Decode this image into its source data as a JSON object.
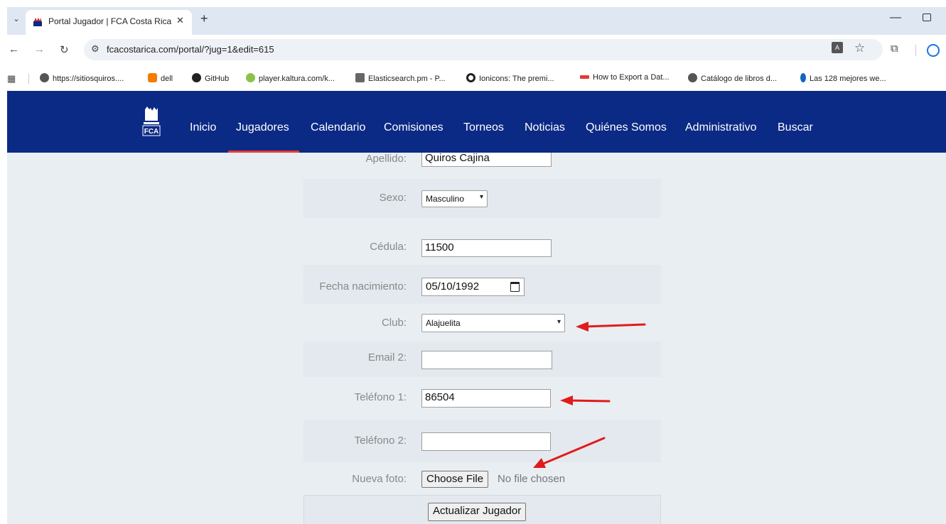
{
  "browser": {
    "tab_title": "Portal Jugador | FCA Costa Rica",
    "url": "fcacostarica.com/portal/?jug=1&edit=615",
    "bookmarks": [
      "https://sitiosquiros....",
      "dell",
      "GitHub",
      "player.kaltura.com/k...",
      "Elasticsearch.pm - P...",
      "Ionicons: The premi...",
      "How to Export a Dat...",
      "Catálogo de libros d...",
      "Las 128 mejores we..."
    ]
  },
  "site": {
    "logo_text": "FCA",
    "nav": [
      "Inicio",
      "Jugadores",
      "Calendario",
      "Comisiones",
      "Torneos",
      "Noticias",
      "Quiénes Somos",
      "Administrativo",
      "Buscar"
    ],
    "active_nav": "Jugadores"
  },
  "form": {
    "apellido": {
      "label": "Apellido:",
      "value": "Quiros Cajina"
    },
    "sexo": {
      "label": "Sexo:",
      "value": "Masculino"
    },
    "cedula": {
      "label": "Cédula:",
      "value": "11500"
    },
    "fecha_nacimiento": {
      "label": "Fecha nacimiento:",
      "value": "05/10/1992"
    },
    "club": {
      "label": "Club:",
      "value": "Alajuelita"
    },
    "email2": {
      "label": "Email 2:",
      "value": ""
    },
    "telefono1": {
      "label": "Teléfono 1:",
      "value": "86504"
    },
    "telefono2": {
      "label": "Teléfono 2:",
      "value": ""
    },
    "nueva_foto": {
      "label": "Nueva foto:",
      "button": "Choose File",
      "status": "No file chosen"
    },
    "submit_label": "Actualizar Jugador"
  },
  "colors": {
    "nav_bg": "#0b2a85",
    "nav_active_underline": "#e53935",
    "annotation_arrow": "#e01b1b"
  }
}
